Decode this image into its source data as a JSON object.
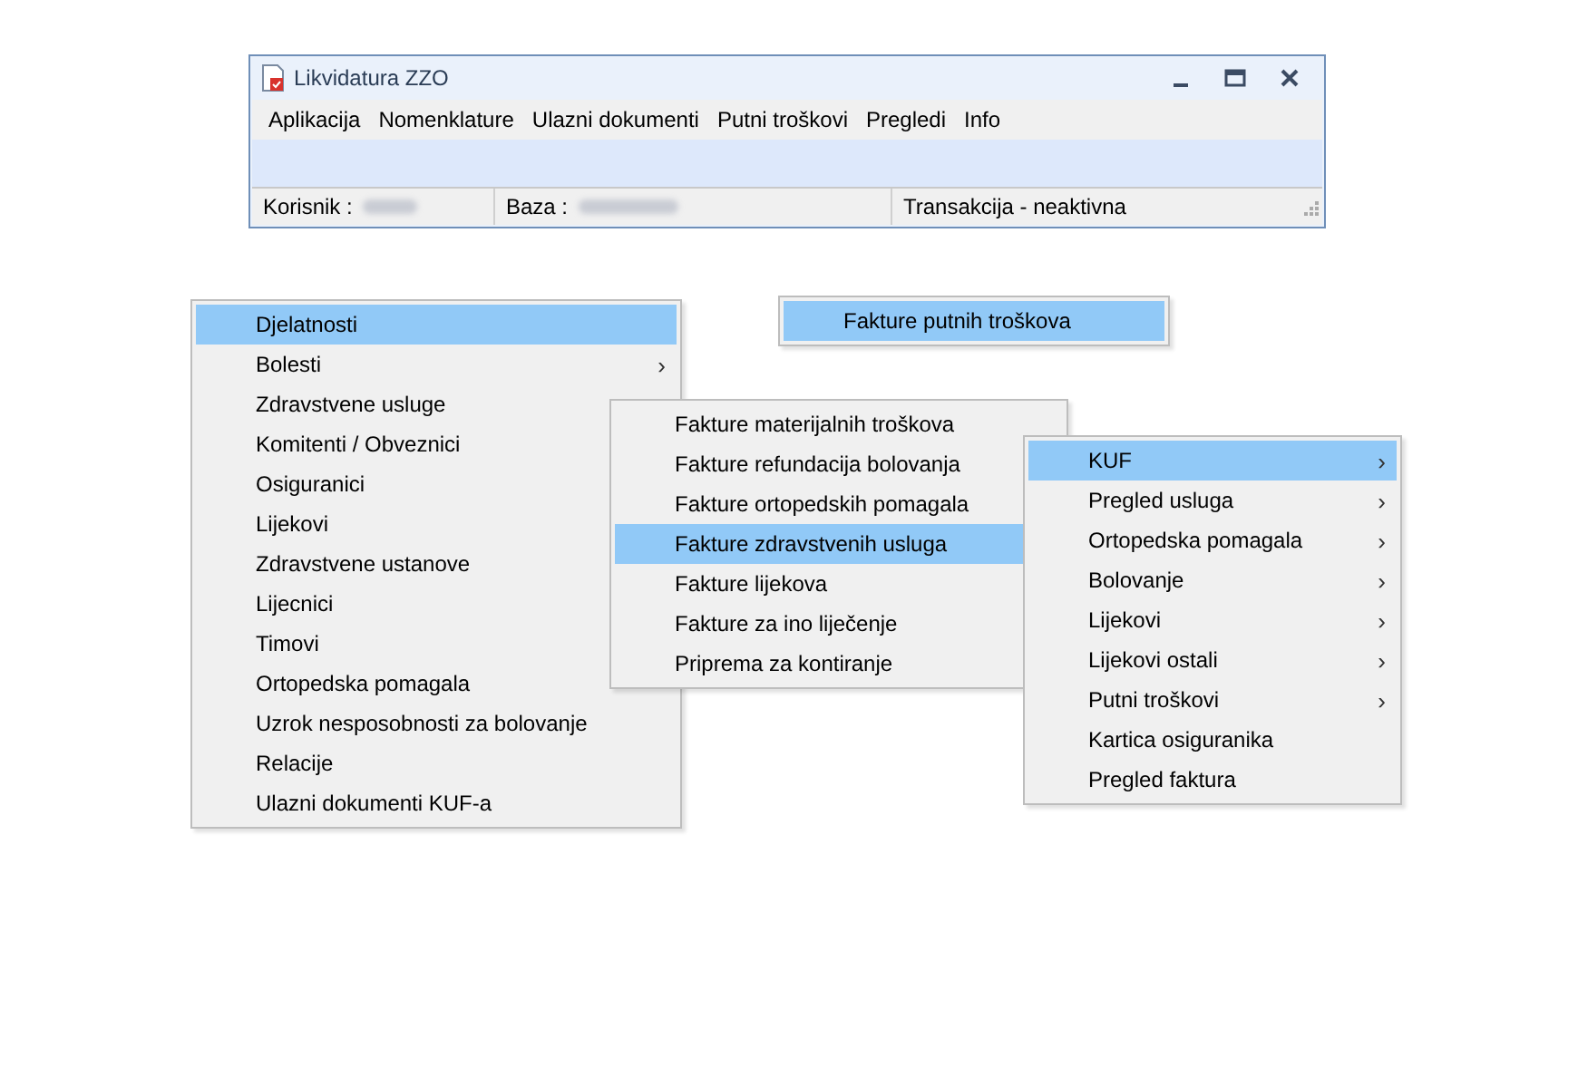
{
  "window": {
    "title": "Likvidatura ZZO",
    "menu_bar": [
      "Aplikacija",
      "Nomenklature",
      "Ulazni dokumenti",
      "Putni troškovi",
      "Pregledi",
      "Info"
    ],
    "status_bar": [
      {
        "label": "Korisnik :",
        "redacted": true
      },
      {
        "label": "Baza :",
        "redacted": true
      },
      {
        "label": "Transakcija - neaktivna",
        "redacted": false
      }
    ]
  },
  "menus": [
    {
      "items": [
        {
          "label": "Djelatnosti",
          "selected": true
        },
        {
          "label": "Bolesti",
          "selected": false,
          "arrow": "›"
        },
        {
          "label": "Zdravstvene usluge",
          "selected": false
        },
        {
          "label": "Komitenti / Obveznici",
          "selected": false
        },
        {
          "label": "Osiguranici",
          "selected": false
        },
        {
          "label": "Lijekovi",
          "selected": false
        },
        {
          "label": "Zdravstvene ustanove",
          "selected": false
        },
        {
          "label": "Lijecnici",
          "selected": false
        },
        {
          "label": "Timovi",
          "selected": false
        },
        {
          "label": "Ortopedska pomagala",
          "selected": false
        },
        {
          "label": "Uzrok nesposobnosti za bolovanje",
          "selected": false
        },
        {
          "label": "Relacije",
          "selected": false
        },
        {
          "label": "Ulazni dokumenti KUF-a",
          "selected": false
        }
      ]
    },
    {
      "items": [
        {
          "label": "Fakture putnih troškova",
          "selected": true
        }
      ]
    },
    {
      "items": [
        {
          "label": "Fakture materijalnih troškova",
          "selected": false
        },
        {
          "label": "Fakture refundacija bolovanja",
          "selected": false
        },
        {
          "label": "Fakture ortopedskih pomagala",
          "selected": false
        },
        {
          "label": "Fakture zdravstvenih usluga",
          "selected": true
        },
        {
          "label": "Fakture lijekova",
          "selected": false
        },
        {
          "label": "Fakture za ino liječenje",
          "selected": false
        },
        {
          "label": "Priprema za kontiranje",
          "selected": false
        }
      ]
    },
    {
      "items": [
        {
          "label": "KUF",
          "selected": true,
          "arrow": "›"
        },
        {
          "label": "Pregled usluga",
          "selected": false,
          "arrow": "›"
        },
        {
          "label": "Ortopedska pomagala",
          "selected": false,
          "arrow": "›"
        },
        {
          "label": "Bolovanje",
          "selected": false,
          "arrow": "›"
        },
        {
          "label": "Lijekovi",
          "selected": false,
          "arrow": "›"
        },
        {
          "label": "Lijekovi ostali",
          "selected": false,
          "arrow": "›"
        },
        {
          "label": "Putni troškovi",
          "selected": false,
          "arrow": "›"
        },
        {
          "label": "Kartica osiguranika",
          "selected": false
        },
        {
          "label": "Pregled faktura",
          "selected": false
        }
      ]
    }
  ]
}
